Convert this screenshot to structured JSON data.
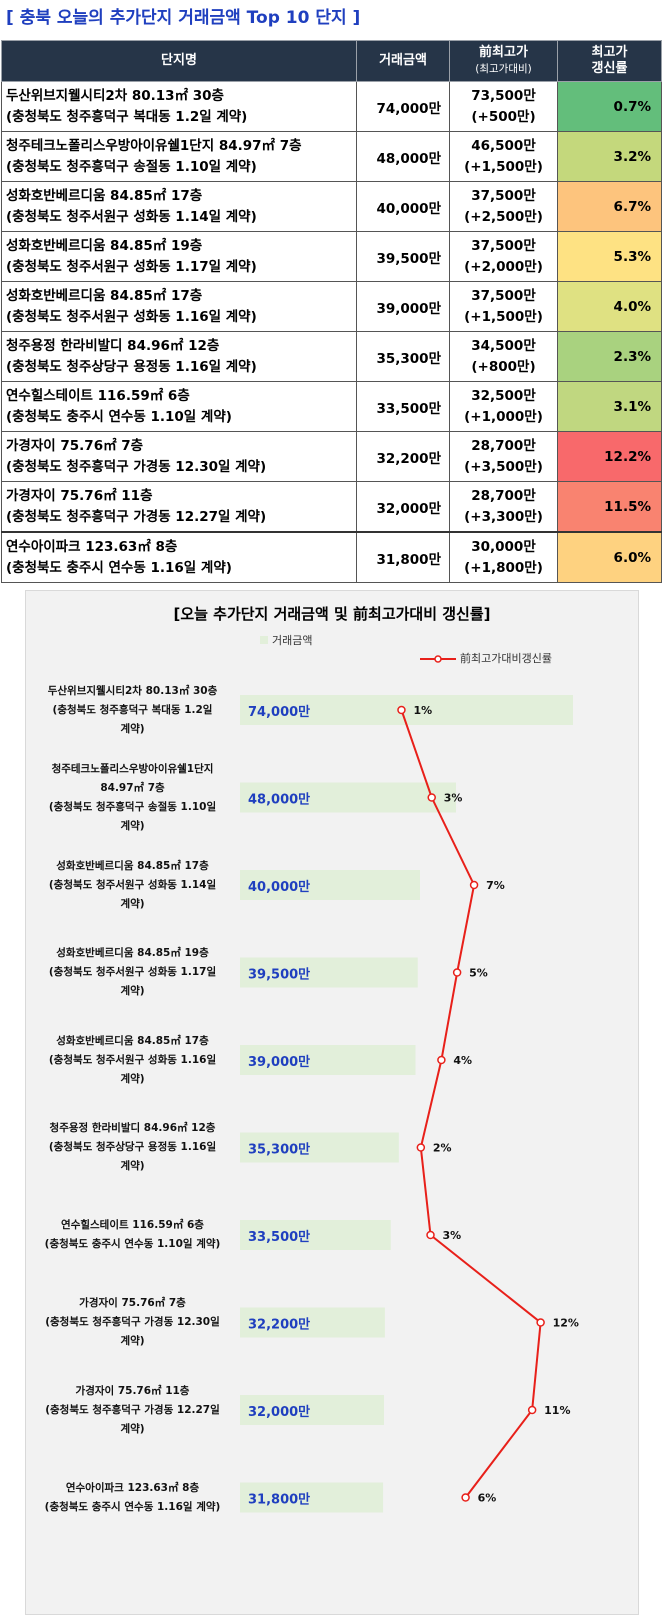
{
  "title": "[ 충북 오늘의 추가단지 거래금액 Top 10 단지 ]",
  "table": {
    "headers": {
      "name": "단지명",
      "price": "거래금액",
      "prev_line1": "前최고가",
      "prev_line2": "(최고가대비)",
      "rate_line1": "최고가",
      "rate_line2": "갱신률"
    },
    "rows": [
      {
        "name": "두산위브지웰시티2차 80.13㎡ 30층",
        "loc": "(충청북도 청주흥덕구 복대동 1.2일 계약)",
        "price": "74,000만",
        "prev": "73,500만",
        "diff": "(+500만)",
        "rate": "0.7%",
        "color": "#63be7b"
      },
      {
        "name": "청주테크노폴리스우방아이유쉘1단지 84.97㎡ 7층",
        "loc": "(충청북도 청주흥덕구 송절동 1.10일 계약)",
        "price": "48,000만",
        "prev": "46,500만",
        "diff": "(+1,500만)",
        "rate": "3.2%",
        "color": "#c4d87c"
      },
      {
        "name": "성화호반베르디움 84.85㎡ 17층",
        "loc": "(충청북도 청주서원구 성화동 1.14일 계약)",
        "price": "40,000만",
        "prev": "37,500만",
        "diff": "(+2,500만)",
        "rate": "6.7%",
        "color": "#fdc47d"
      },
      {
        "name": "성화호반베르디움 84.85㎡ 19층",
        "loc": "(충청북도 청주서원구 성화동 1.17일 계약)",
        "price": "39,500만",
        "prev": "37,500만",
        "diff": "(+2,000만)",
        "rate": "5.3%",
        "color": "#fee283"
      },
      {
        "name": "성화호반베르디움 84.85㎡ 17층",
        "loc": "(충청북도 청주서원구 성화동 1.16일 계약)",
        "price": "39,000만",
        "prev": "37,500만",
        "diff": "(+1,500만)",
        "rate": "4.0%",
        "color": "#dfe182"
      },
      {
        "name": "청주용정 한라비발디 84.96㎡ 12층",
        "loc": "(충청북도 청주상당구 용정동 1.16일 계약)",
        "price": "35,300만",
        "prev": "34,500만",
        "diff": "(+800만)",
        "rate": "2.3%",
        "color": "#a9d27f"
      },
      {
        "name": "연수힐스테이트 116.59㎡ 6층",
        "loc": "(충청북도 충주시 연수동 1.10일 계약)",
        "price": "33,500만",
        "prev": "32,500만",
        "diff": "(+1,000만)",
        "rate": "3.1%",
        "color": "#c0d780"
      },
      {
        "name": "가경자이 75.76㎡ 7층",
        "loc": "(충청북도 청주흥덕구 가경동 12.30일 계약)",
        "price": "32,200만",
        "prev": "28,700만",
        "diff": "(+3,500만)",
        "rate": "12.2%",
        "color": "#f8696b"
      },
      {
        "name": "가경자이 75.76㎡ 11층",
        "loc": "(충청북도 청주흥덕구 가경동 12.27일 계약)",
        "price": "32,000만",
        "prev": "28,700만",
        "diff": "(+3,300만)",
        "rate": "11.5%",
        "color": "#f98370"
      },
      {
        "name": "연수아이파크 123.63㎡ 8층",
        "loc": "(충청북도 충주시 연수동 1.16일 계약)",
        "price": "31,800만",
        "prev": "30,000만",
        "diff": "(+1,800만)",
        "rate": "6.0%",
        "color": "#fed280"
      }
    ]
  },
  "chart_data": {
    "type": "bar",
    "title": "[오늘 추가단지 거래금액 및 前최고가대비 갱신률]",
    "legend": [
      "거래금액",
      "前최고가대비갱신률"
    ],
    "categories": [
      [
        "두산위브지웰시티2차 80.13㎡ 30층",
        "(충청북도 청주흥덕구 복대동 1.2일",
        "계약)"
      ],
      [
        "청주테크노폴리스우방아이유쉘1단지",
        "84.97㎡ 7층",
        "(충청북도 청주흥덕구 송절동 1.10일",
        "계약)"
      ],
      [
        "성화호반베르디움 84.85㎡ 17층",
        "(충청북도 청주서원구 성화동 1.14일",
        "계약)"
      ],
      [
        "성화호반베르디움 84.85㎡ 19층",
        "(충청북도 청주서원구 성화동 1.17일",
        "계약)"
      ],
      [
        "성화호반베르디움 84.85㎡ 17층",
        "(충청북도 청주서원구 성화동 1.16일",
        "계약)"
      ],
      [
        "청주용정 한라비발디 84.96㎡ 12층",
        "(충청북도 청주상당구 용정동 1.16일",
        "계약)"
      ],
      [
        "연수힐스테이트 116.59㎡ 6층",
        "(충청북도 충주시 연수동 1.10일 계약)"
      ],
      [
        "가경자이 75.76㎡ 7층",
        "(충청북도 청주흥덕구 가경동 12.30일",
        "계약)"
      ],
      [
        "가경자이 75.76㎡ 11층",
        "(충청북도 청주흥덕구 가경동 12.27일",
        "계약)"
      ],
      [
        "연수아이파크 123.63㎡ 8층",
        "(충청북도 충주시 연수동 1.16일 계약)"
      ]
    ],
    "series": [
      {
        "name": "거래금액",
        "type": "bar",
        "values": [
          74000,
          48000,
          40000,
          39500,
          39000,
          35300,
          33500,
          32200,
          32000,
          31800
        ],
        "labels": [
          "74,000만",
          "48,000만",
          "40,000만",
          "39,500만",
          "39,000만",
          "35,300만",
          "33,500만",
          "32,200만",
          "32,000만",
          "31,800만"
        ]
      },
      {
        "name": "前최고가대비갱신률",
        "type": "line",
        "values": [
          0.7,
          3.2,
          6.7,
          5.3,
          4.0,
          2.3,
          3.1,
          12.2,
          11.5,
          6.0
        ],
        "labels": [
          "1%",
          "3%",
          "7%",
          "5%",
          "4%",
          "2%",
          "3%",
          "12%",
          "11%",
          "6%"
        ]
      }
    ],
    "bar_color": "#e2efda",
    "bar_label_color": "#1f3fbf",
    "line_color": "#e8201a"
  }
}
